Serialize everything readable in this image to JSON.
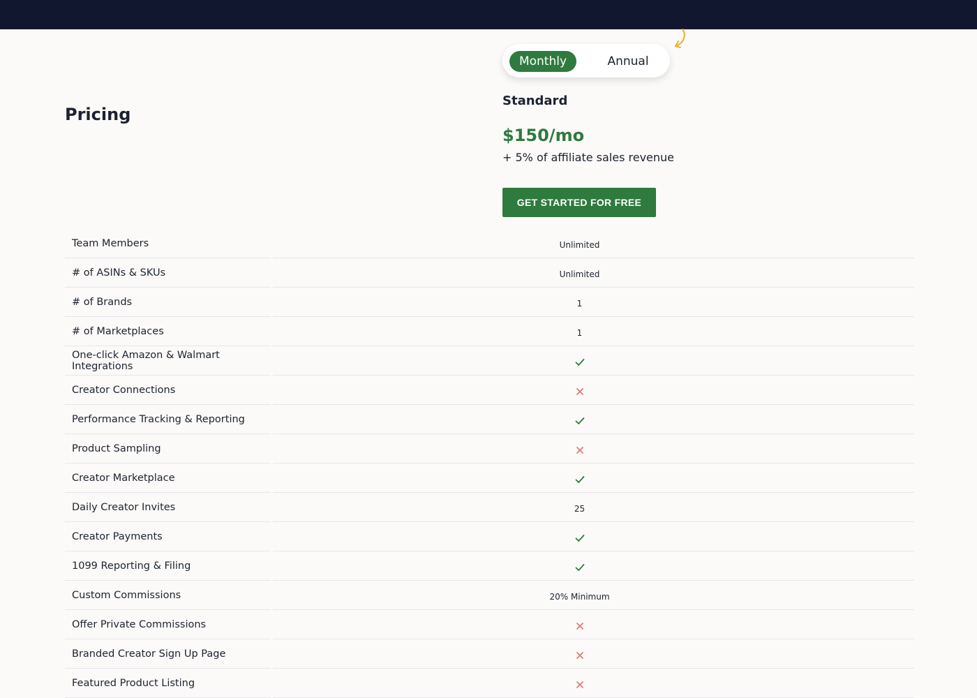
{
  "page": {
    "title": "Pricing"
  },
  "billing_toggle": {
    "monthly_label": "Monthly",
    "annual_label": "Annual",
    "selected": "Monthly"
  },
  "plan": {
    "name": "Standard",
    "price": "$150/mo",
    "note": "+ 5% of affiliate sales revenue",
    "cta_label": "GET STARTED FOR FREE"
  },
  "colors": {
    "brand_green": "#2f7a3e",
    "topbar": "#121730",
    "cross_red": "#e07a7a",
    "arrow_yellow": "#e8b22a"
  },
  "features": [
    {
      "label": "Team Members",
      "type": "text",
      "value": "Unlimited"
    },
    {
      "label": "# of ASINs & SKUs",
      "type": "text",
      "value": "Unlimited"
    },
    {
      "label": "# of Brands",
      "type": "text",
      "value": "1"
    },
    {
      "label": "# of Marketplaces",
      "type": "text",
      "value": "1"
    },
    {
      "label": "One-click Amazon & Walmart Integrations",
      "type": "check",
      "value": null
    },
    {
      "label": "Creator Connections",
      "type": "cross",
      "value": null
    },
    {
      "label": "Performance Tracking & Reporting",
      "type": "check",
      "value": null
    },
    {
      "label": "Product Sampling",
      "type": "cross",
      "value": null
    },
    {
      "label": "Creator Marketplace",
      "type": "check",
      "value": null
    },
    {
      "label": "Daily Creator Invites",
      "type": "text",
      "value": "25"
    },
    {
      "label": "Creator Payments",
      "type": "check",
      "value": null
    },
    {
      "label": "1099 Reporting & Filing",
      "type": "check",
      "value": null
    },
    {
      "label": "Custom Commissions",
      "type": "text",
      "value": "20% Minimum"
    },
    {
      "label": "Offer Private Commissions",
      "type": "cross",
      "value": null
    },
    {
      "label": "Branded Creator Sign Up Page",
      "type": "cross",
      "value": null
    },
    {
      "label": "Featured Product Listing",
      "type": "cross",
      "value": null
    }
  ]
}
